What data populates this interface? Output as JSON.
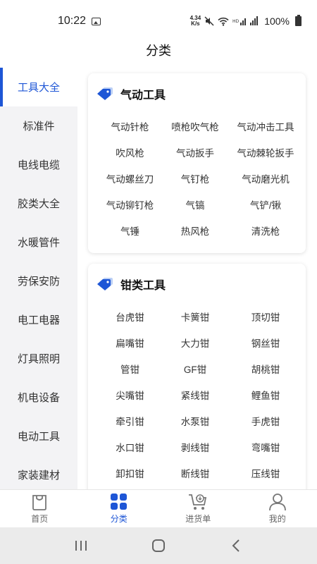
{
  "status": {
    "time": "10:22",
    "speed_top": "4.34",
    "speed_bottom": "K/s",
    "battery": "100%"
  },
  "page_title": "分类",
  "sidebar": {
    "items": [
      {
        "label": "工具大全",
        "active": true
      },
      {
        "label": "标准件"
      },
      {
        "label": "电线电缆"
      },
      {
        "label": "胶类大全"
      },
      {
        "label": "水暖管件"
      },
      {
        "label": "劳保安防"
      },
      {
        "label": "电工电器"
      },
      {
        "label": "灯具照明"
      },
      {
        "label": "机电设备"
      },
      {
        "label": "电动工具"
      },
      {
        "label": "家装建材"
      }
    ]
  },
  "sections": [
    {
      "title": "气动工具",
      "items": [
        "气动针枪",
        "喷枪吹气枪",
        "气动冲击工具",
        "吹风枪",
        "气动扳手",
        "气动棘轮扳手",
        "气动螺丝刀",
        "气钉枪",
        "气动磨光机",
        "气动铆钉枪",
        "气镐",
        "气铲/锹",
        "气锤",
        "热风枪",
        "清洗枪"
      ]
    },
    {
      "title": "钳类工具",
      "items": [
        "台虎钳",
        "卡簧钳",
        "顶切钳",
        "扁嘴钳",
        "大力钳",
        "钢丝钳",
        "管钳",
        "GF钳",
        "胡桃钳",
        "尖嘴钳",
        "紧线钳",
        "鲤鱼钳",
        "牵引钳",
        "水泵钳",
        "手虎钳",
        "水口钳",
        "剥线钳",
        "弯嘴钳",
        "卸扣钳",
        "断线钳",
        "压线钳"
      ]
    }
  ],
  "tabbar": {
    "home": "首页",
    "category": "分类",
    "purchase": "进货单",
    "mine": "我的"
  },
  "colors": {
    "accent": "#1e56d6",
    "sidebar_bg": "#f3f3f5"
  }
}
